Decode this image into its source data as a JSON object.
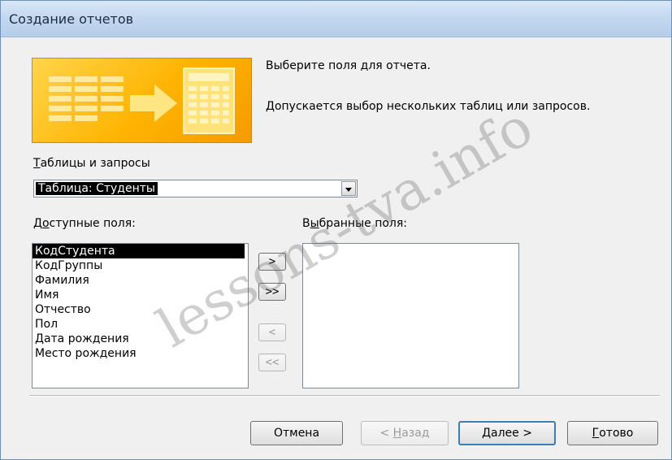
{
  "window": {
    "title": "Создание отчетов"
  },
  "intro": {
    "line1": "Выберите поля для отчета.",
    "line2": "Допускается выбор нескольких таблиц или запросов."
  },
  "source": {
    "label_hotkey": "Т",
    "label_rest": "аблицы и запросы",
    "selected": "Таблица: Студенты"
  },
  "available": {
    "label_pre": "Д",
    "label_hotkey": "о",
    "label_rest": "ступные поля:",
    "items": [
      "КодСтудента",
      "КодГруппы",
      "Фамилия",
      "Имя",
      "Отчество",
      "Пол",
      "Дата рождения",
      "Место рождения"
    ],
    "selected_index": 0
  },
  "selected_fields": {
    "label_pre": "В",
    "label_hotkey": "ы",
    "label_rest": "бранные поля:",
    "items": []
  },
  "move_buttons": {
    "add_one": ">",
    "add_all": ">>",
    "remove_one": "<",
    "remove_all": "<<"
  },
  "footer": {
    "cancel": "Отмена",
    "back_pre": "< ",
    "back_hotkey": "Н",
    "back_rest": "азад",
    "next_hotkey": "Д",
    "next_rest": "алее >",
    "finish_hotkey": "Г",
    "finish_rest": "отово"
  },
  "watermark": "lessons-tva.info",
  "colors": {
    "banner_orange": "#ffb300",
    "selection": "#000000",
    "default_button_border": "#3c7fb1"
  }
}
